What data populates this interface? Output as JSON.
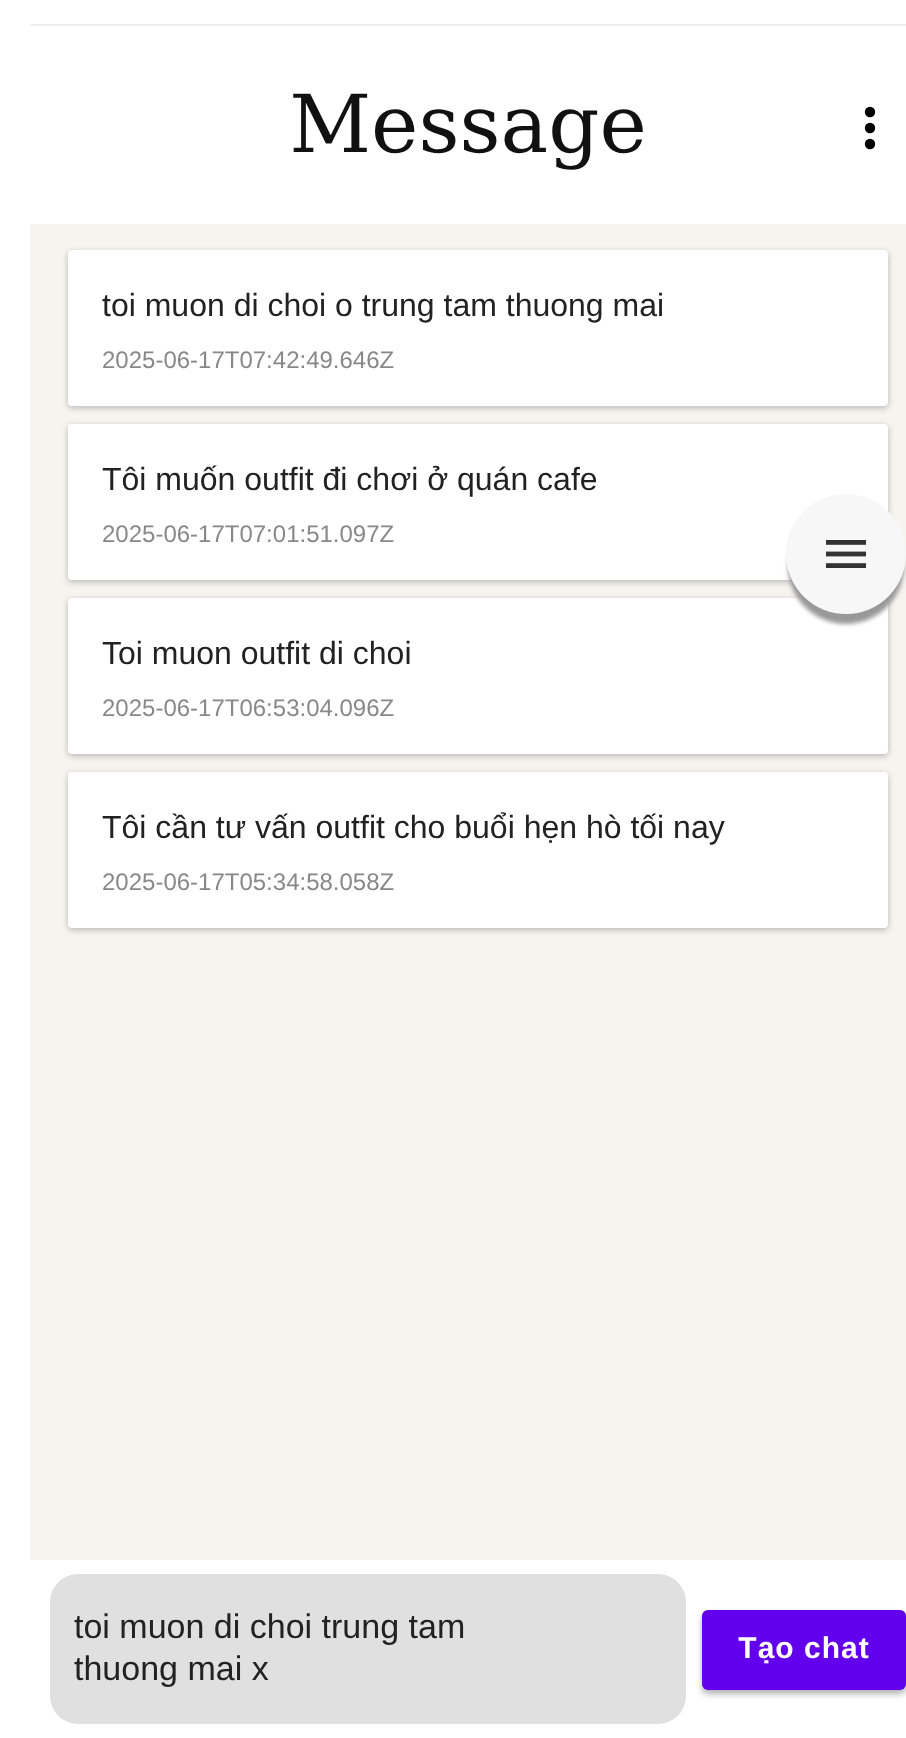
{
  "header": {
    "title": "Message"
  },
  "messages": [
    {
      "text": "toi muon di choi o trung tam thuong mai",
      "time": "2025-06-17T07:42:49.646Z"
    },
    {
      "text": "Tôi muốn outfit đi chơi ở quán cafe",
      "time": "2025-06-17T07:01:51.097Z"
    },
    {
      "text": "Toi muon outfit di choi",
      "time": "2025-06-17T06:53:04.096Z"
    },
    {
      "text": "Tôi cần tư vấn outfit cho buổi hẹn hò tối nay",
      "time": "2025-06-17T05:34:58.058Z"
    }
  ],
  "composer": {
    "value": "toi muon di choi trung tam\nthuong mai x",
    "button": "Tạo chat"
  }
}
